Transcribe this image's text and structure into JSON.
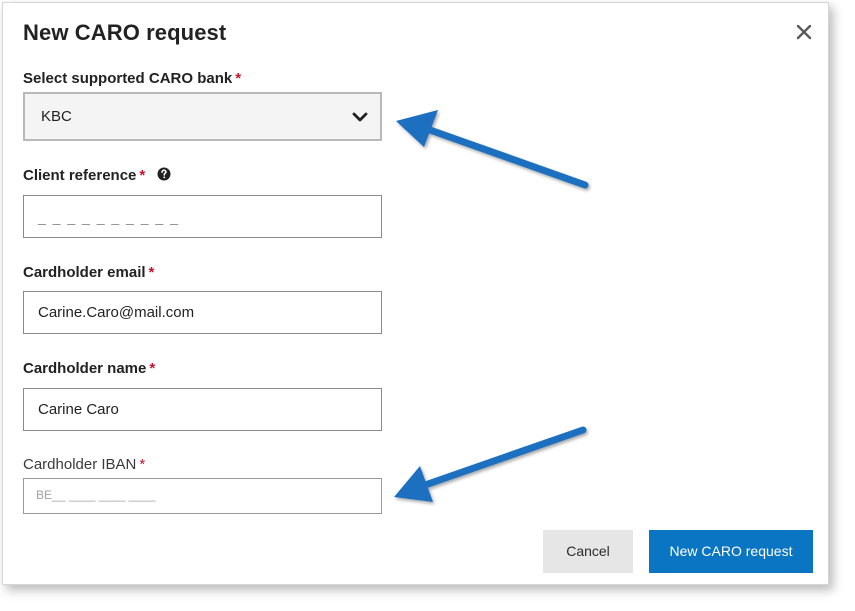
{
  "dialog": {
    "title": "New CARO request",
    "close_icon": "close-icon"
  },
  "fields": {
    "bank": {
      "label": "Select supported CARO bank",
      "required_mark": "*",
      "value": "KBC",
      "icon": "chevron-down-icon"
    },
    "client_reference": {
      "label": "Client reference",
      "required_mark": "*",
      "help_icon": "question-circle-icon",
      "placeholder": "_ _ _ _ _ _ _ _ _ _"
    },
    "email": {
      "label": "Cardholder email",
      "required_mark": "*",
      "value": "Carine.Caro@mail.com"
    },
    "name": {
      "label": "Cardholder name",
      "required_mark": "*",
      "value": "Carine Caro"
    },
    "iban": {
      "label": "Cardholder IBAN",
      "required_mark": "*",
      "placeholder": "BE__ ____ ____ ____"
    }
  },
  "buttons": {
    "cancel": "Cancel",
    "submit": "New CARO request"
  },
  "colors": {
    "accent": "#0a75c2",
    "required": "#c8102e",
    "annotation_arrow": "#1a6fbf"
  }
}
